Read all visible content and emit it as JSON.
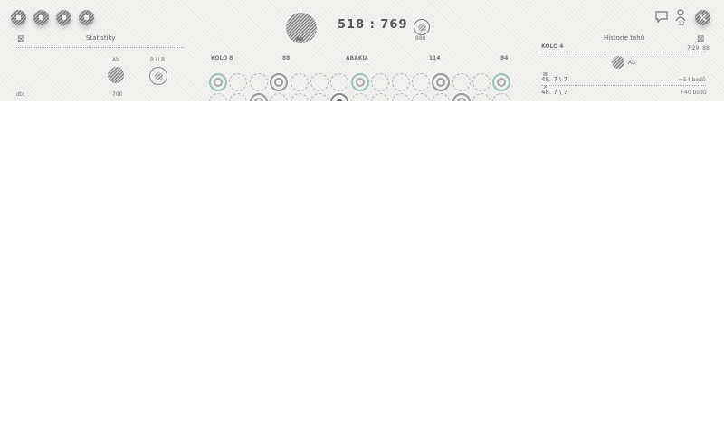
{
  "header": {
    "score": "518 : 769",
    "left_avatar_label": "Ab",
    "right_badge_label": "888"
  },
  "stats_panel": {
    "title": "Statistiky",
    "col_player1": "Ab",
    "col_player2": "R.U.R",
    "row_label": "dtc",
    "row_value": "700"
  },
  "board": {
    "headers": [
      "KOLO 8",
      "88",
      "ABAKU",
      "114",
      "84"
    ]
  },
  "history_panel": {
    "title": "Historie tahů",
    "round_label": "KOLO 4",
    "round_sub": "7.29. 88",
    "player_label": "Ab",
    "entries": [
      {
        "move": "48. 7 \\ 7",
        "points": "+54 bodů"
      },
      {
        "move": "48. 7 \\ 7",
        "points": "+40 bodů"
      }
    ]
  },
  "top_right": {
    "user_count": "12"
  }
}
